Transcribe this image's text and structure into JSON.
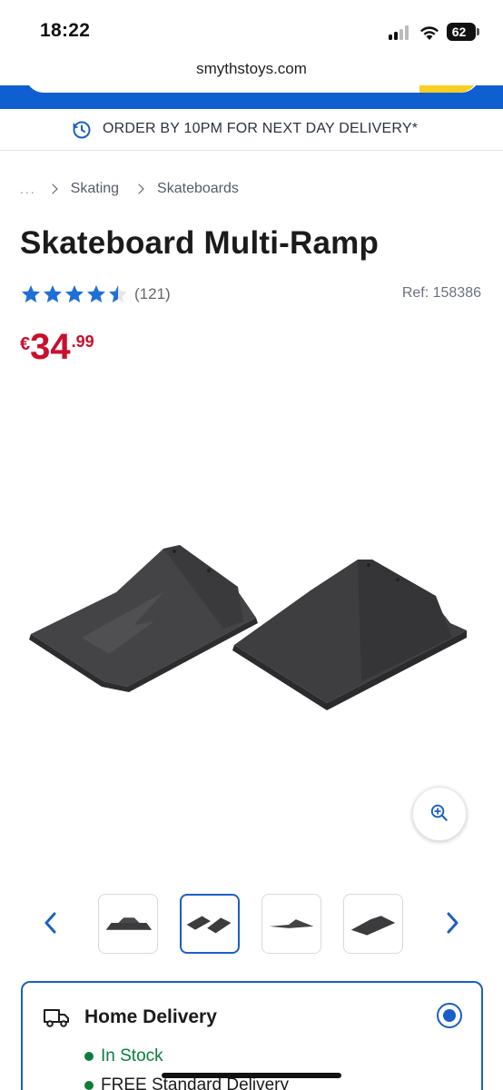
{
  "status_bar": {
    "time": "18:22",
    "battery": "62"
  },
  "browser": {
    "url": "smythstoys.com"
  },
  "banner": {
    "text": "ORDER BY 10PM FOR NEXT DAY DELIVERY*",
    "icon": "clock-icon"
  },
  "breadcrumb": {
    "ellipsis": "...",
    "items": [
      "Skating",
      "Skateboards"
    ]
  },
  "product": {
    "title": "Skateboard Multi-Ramp",
    "rating": 4.5,
    "rating_count": "(121)",
    "ref": "Ref: 158386",
    "price": {
      "currency": "€",
      "whole": "34",
      "cents": ".99"
    }
  },
  "gallery": {
    "thumbnail_count": 4,
    "active_index": 1
  },
  "delivery": {
    "title": "Home Delivery",
    "selected": true,
    "lines": [
      {
        "text": "In Stock",
        "color": "#0a7d3b"
      },
      {
        "text": "FREE Standard Delivery",
        "color": "#1b1b1b"
      }
    ]
  },
  "colors": {
    "brand_blue": "#0f5fd1",
    "accent_yellow": "#f6cf22",
    "price_red": "#c8102e",
    "star_blue": "#1f6fd6",
    "in_stock_green": "#0a7d3b"
  }
}
